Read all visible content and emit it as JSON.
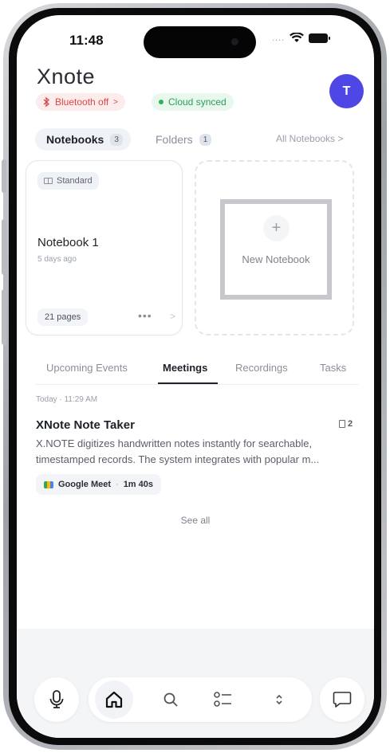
{
  "status_bar": {
    "time": "11:48",
    "signal": "....",
    "wifi_icon": "wifi-icon",
    "battery_icon": "battery-icon"
  },
  "header": {
    "logo": "Xnote",
    "avatar_initial": "T",
    "bluetooth_label": "Bluetooth off",
    "bluetooth_chevron": ">",
    "cloud_label": "Cloud synced"
  },
  "notebook_tabs": {
    "notebooks_label": "Notebooks",
    "notebooks_count": "3",
    "folders_label": "Folders",
    "folders_count": "1",
    "all_notebooks": "All Notebooks >"
  },
  "notebook_card": {
    "type_badge": "Standard",
    "title": "Notebook 1",
    "date": "5 days ago",
    "pages": "21 pages",
    "more": "•••",
    "chevron": ">"
  },
  "new_notebook": {
    "plus": "+",
    "label": "New Notebook"
  },
  "segment_tabs": [
    "Upcoming Events",
    "Meetings",
    "Recordings",
    "Tasks"
  ],
  "meeting": {
    "time": "Today · 11:29 AM",
    "title": "XNote Note Taker",
    "doc_count": "2",
    "desc_line1": "X.NOTE digitizes handwritten notes instantly for searchable,",
    "desc_line2": "timestamped records. The system integrates with popular m...",
    "platform": "Google Meet",
    "separator": "·",
    "duration": "1m 40s"
  },
  "see_all": "See all",
  "nav": [
    "mic-icon",
    "home-icon",
    "search-icon",
    "checklist-icon",
    "expand-icon",
    "chat-icon"
  ],
  "colors": {
    "accent": "#4f47e5",
    "bluetooth_off": "#d84848",
    "cloud_synced": "#2d9c55"
  }
}
